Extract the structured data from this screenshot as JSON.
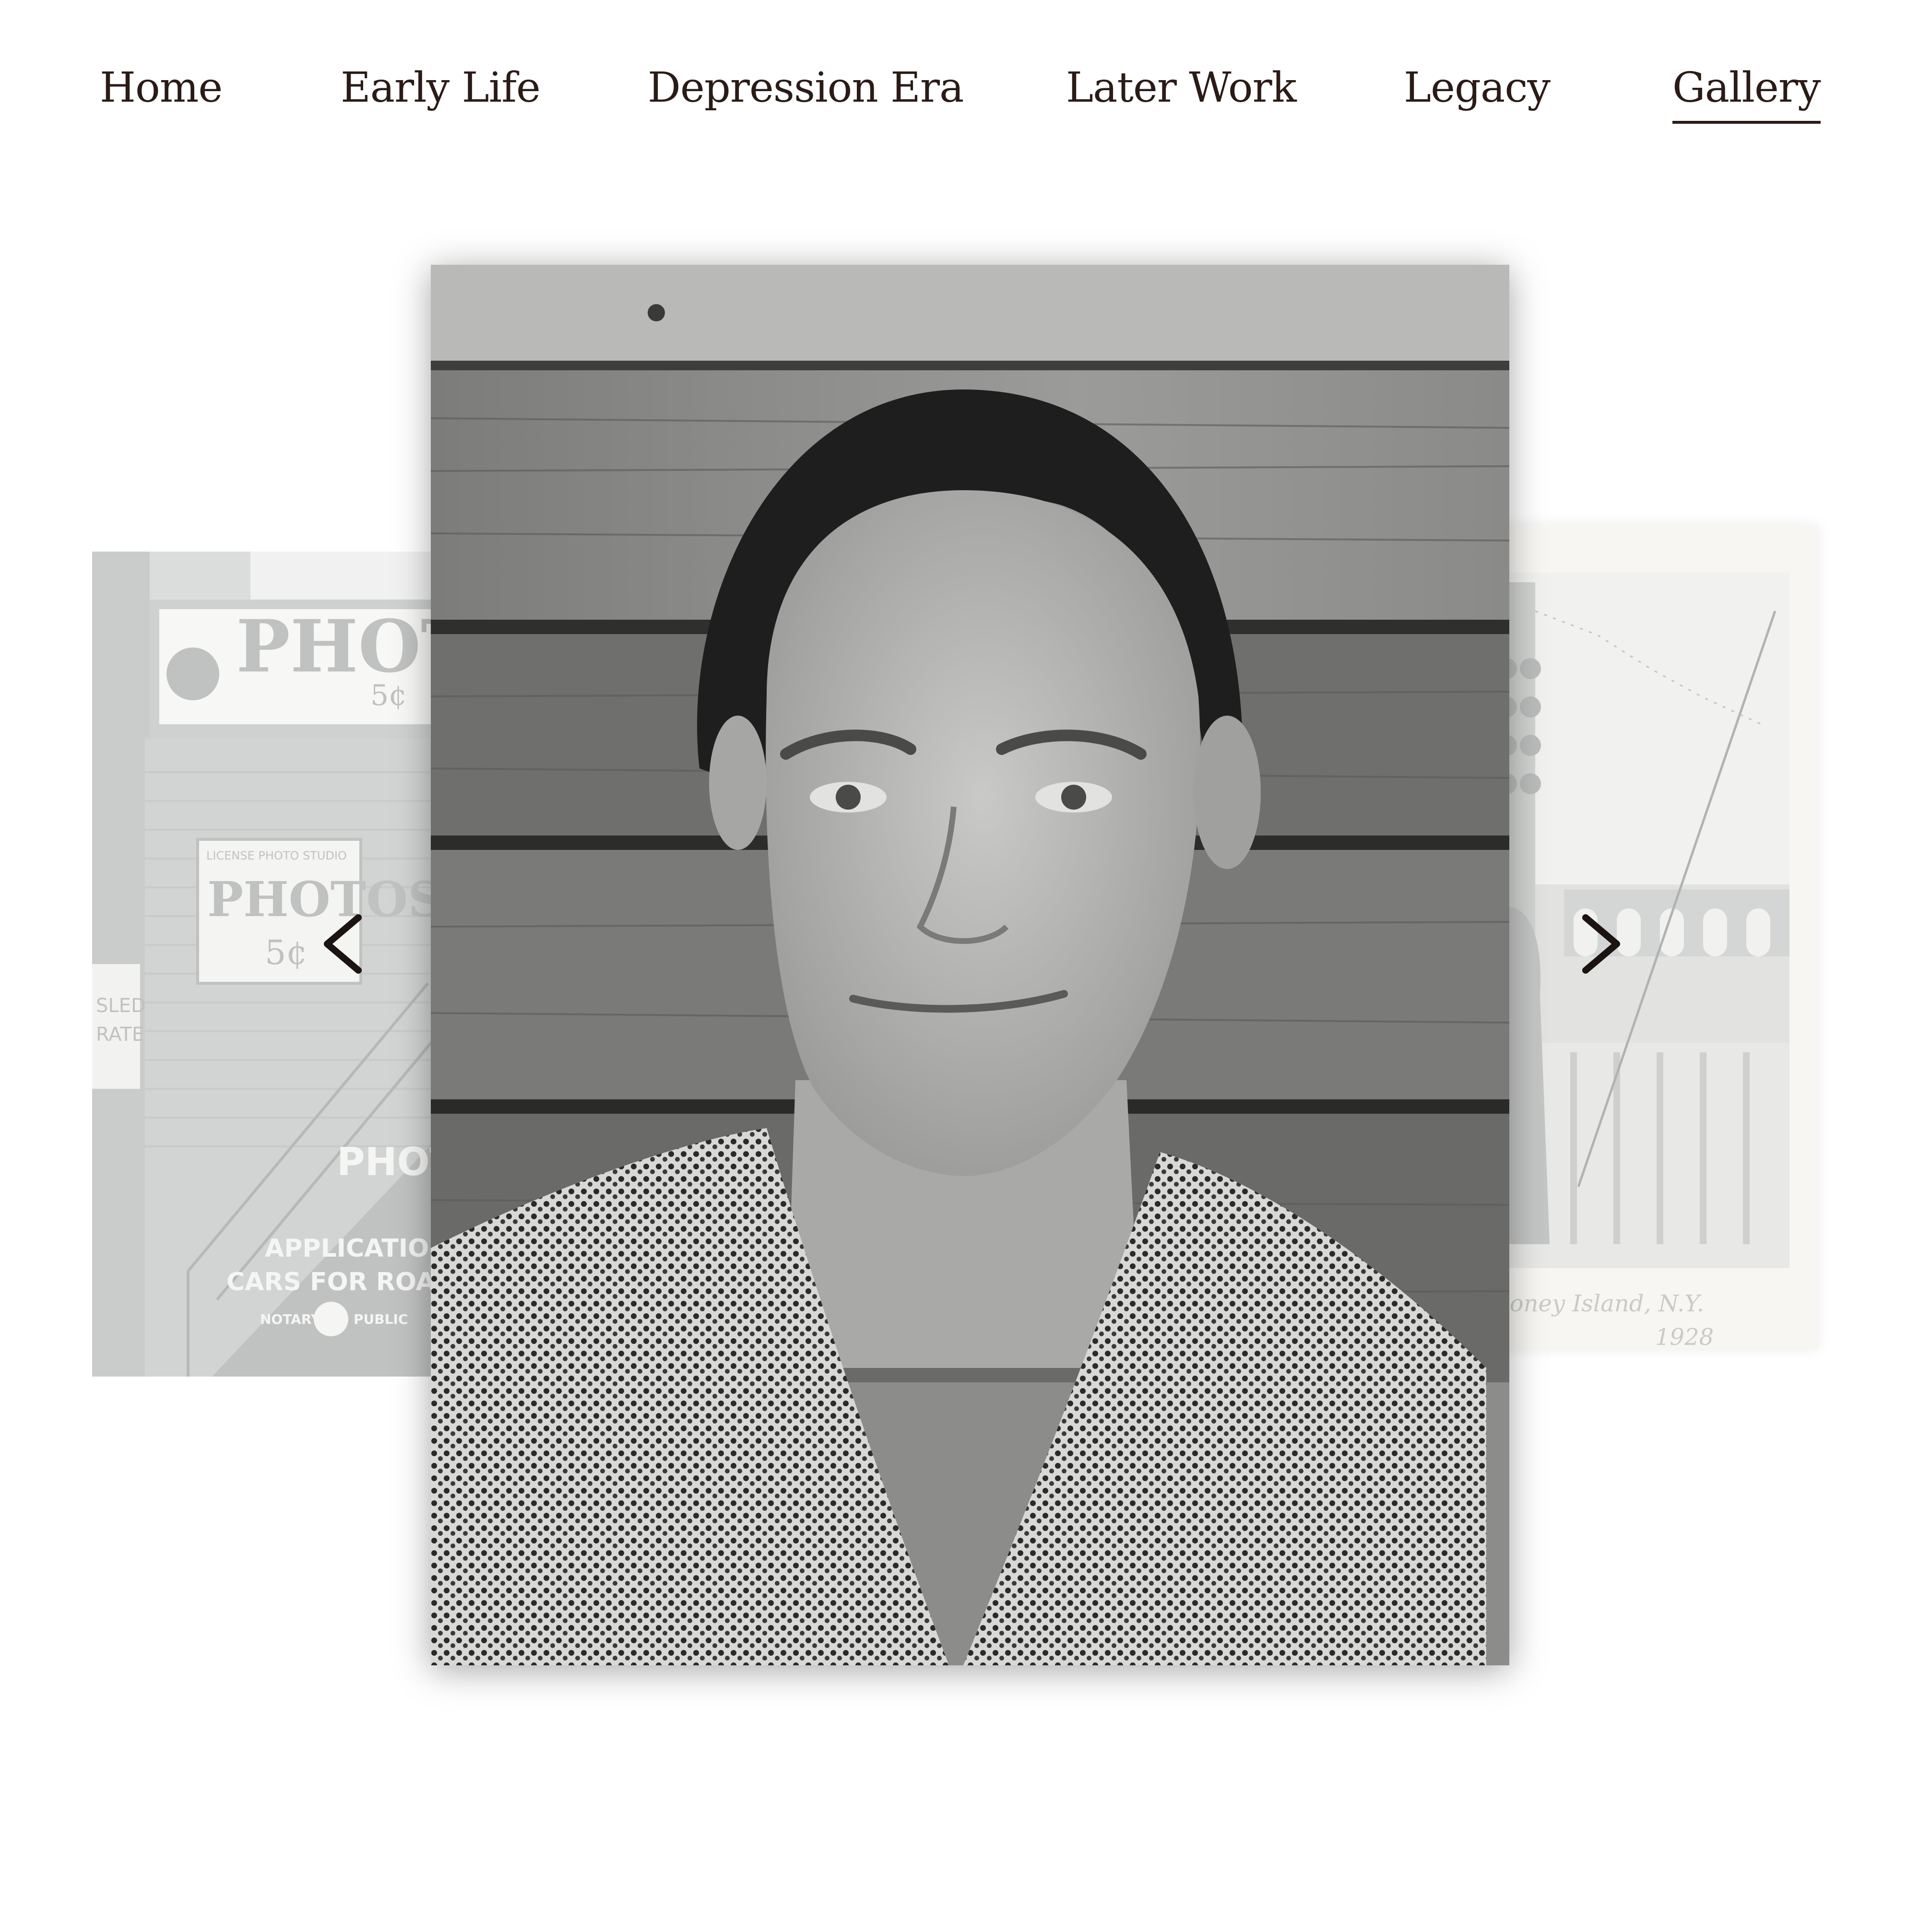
{
  "nav": {
    "items": [
      {
        "label": "Home"
      },
      {
        "label": "Early Life"
      },
      {
        "label": "Depression Era"
      },
      {
        "label": "Later Work"
      },
      {
        "label": "Legacy"
      },
      {
        "label": "Gallery",
        "active": true
      }
    ]
  },
  "gallery": {
    "prev_icon": "chevron-left-icon",
    "next_icon": "chevron-right-icon",
    "left_photo": {
      "sign_1": "PHOTOS",
      "sign_2": "5¢",
      "sign_small": "LICENSE PHOTO STUDIO",
      "sign_3": "PHOTOS",
      "sign_4": "5¢",
      "sign_5": "PHOTO",
      "sign_6": "APPLICATIONS",
      "sign_7": "CARS FOR ROAD TES",
      "sign_8": "NOTARY",
      "sign_9": "PUBLIC",
      "sign_10": "SLED",
      "sign_11": "RATE"
    },
    "right_photo": {
      "caption": "Coney Island, N.Y.",
      "year": "1928"
    }
  },
  "colors": {
    "text": "#2b1b17",
    "background": "#ffffff"
  }
}
